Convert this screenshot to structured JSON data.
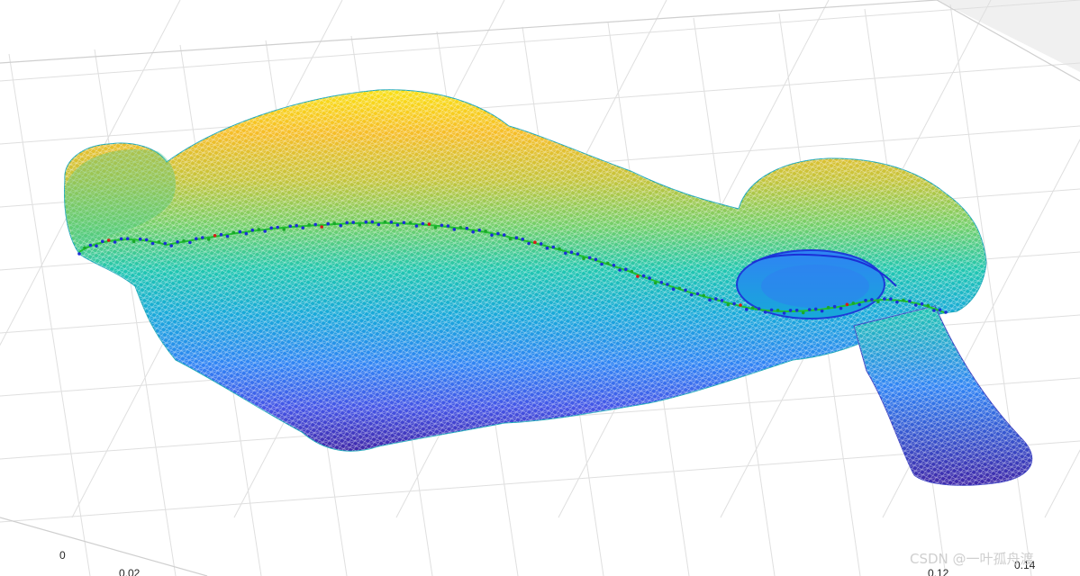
{
  "chart_data": {
    "type": "surface-mesh-3d",
    "title": "",
    "xlabel": "",
    "ylabel": "",
    "zlabel": "",
    "grid": true,
    "colormap": "parula",
    "colormap_stops": [
      "#3e26a8",
      "#4354e6",
      "#2f83f4",
      "#17a9d9",
      "#1fc6b0",
      "#6fcf6a",
      "#c4c43a",
      "#f6bd27",
      "#f9e014"
    ],
    "tick_labels_left_axis": [
      "0",
      "0.02"
    ],
    "tick_labels_right_axis": [
      "0.12",
      "0.14"
    ],
    "overlay_path": {
      "description_colors": [
        "#1b2fd6",
        "#1aa82a",
        "#d81a1a"
      ],
      "line_color": "#20c030"
    }
  },
  "watermark": "CSDN @一叶孤舟渡"
}
